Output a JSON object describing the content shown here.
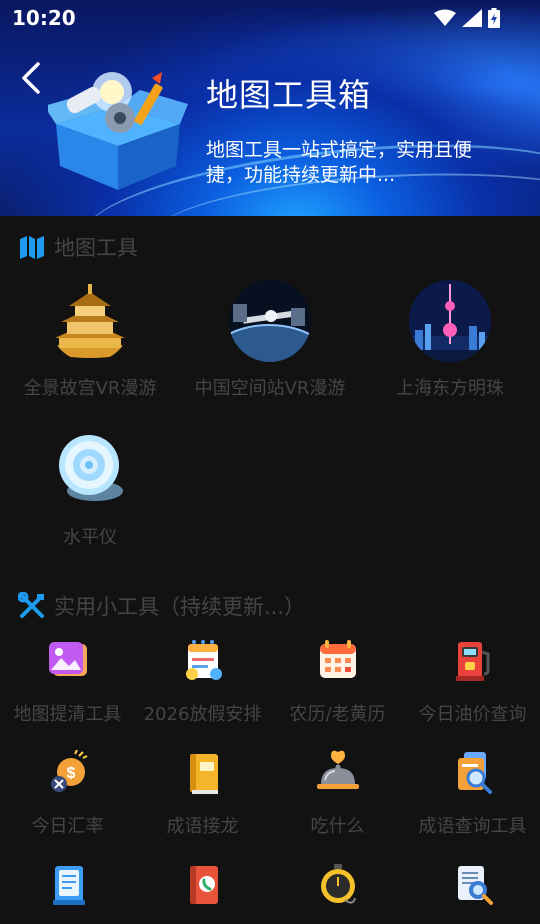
{
  "status_bar": {
    "time": "10:20"
  },
  "header": {
    "title": "地图工具箱",
    "subtitle": "地图工具一站式搞定，实用且便捷，功能持续更新中..."
  },
  "map_tools": {
    "heading": "地图工具",
    "items": [
      {
        "label": "全景故宫VR漫游",
        "icon": "forbidden-city-icon"
      },
      {
        "label": "中国空间站VR漫游",
        "icon": "space-station-icon"
      },
      {
        "label": "上海东方明珠",
        "icon": "oriental-pearl-icon"
      },
      {
        "label": "水平仪",
        "icon": "level-icon"
      }
    ]
  },
  "utilities": {
    "heading": "实用小工具（持续更新...）",
    "items": [
      {
        "label": "地图提清工具",
        "icon": "image-enhance-icon"
      },
      {
        "label": "2026放假安排",
        "icon": "holiday-calendar-icon"
      },
      {
        "label": "农历/老黄历",
        "icon": "lunar-calendar-icon"
      },
      {
        "label": "今日油价查询",
        "icon": "gas-pump-icon"
      },
      {
        "label": "今日汇率",
        "icon": "exchange-rate-icon"
      },
      {
        "label": "成语接龙",
        "icon": "idiom-book-icon"
      },
      {
        "label": "吃什么",
        "icon": "food-cloche-icon"
      },
      {
        "label": "成语查询工具",
        "icon": "idiom-search-icon"
      },
      {
        "label": "",
        "icon": "notebook-icon"
      },
      {
        "label": "",
        "icon": "phone-book-icon"
      },
      {
        "label": "",
        "icon": "stopwatch-icon"
      },
      {
        "label": "",
        "icon": "document-search-icon"
      }
    ]
  },
  "colors": {
    "background": "#121212",
    "accent": "#1e9bf0",
    "label": "#454545"
  }
}
